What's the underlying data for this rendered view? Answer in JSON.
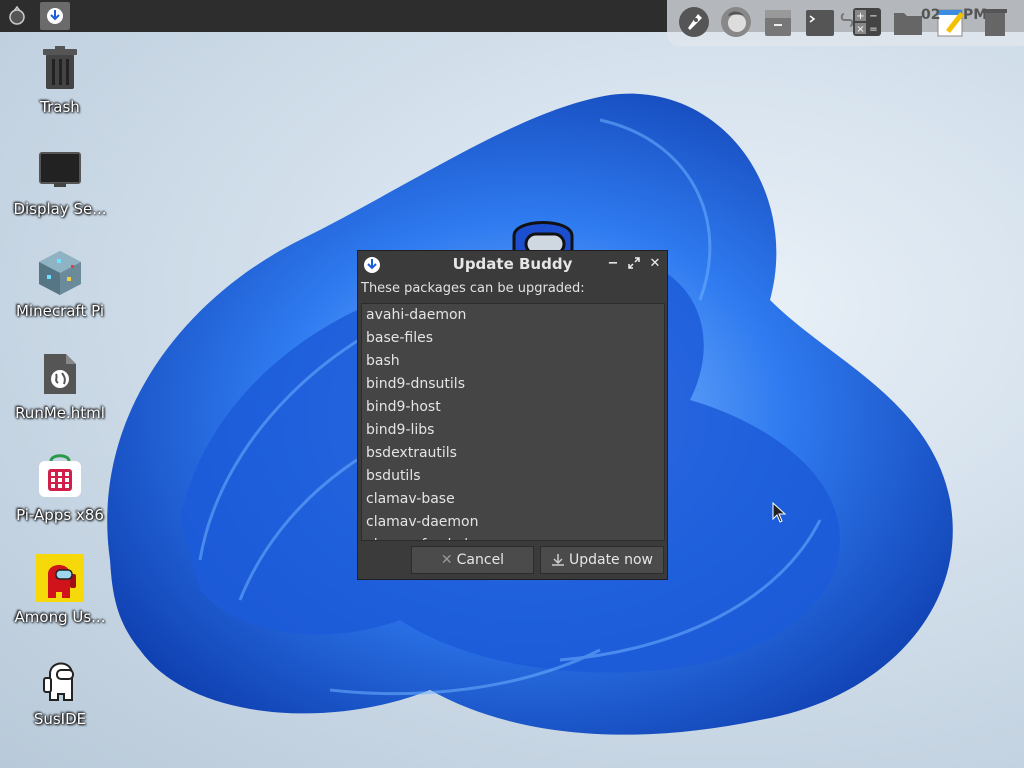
{
  "top_panel": {
    "menu_icon": "raspberry-menu-icon",
    "task_icon": "update-buddy-task-icon"
  },
  "dock": {
    "items": [
      "rocket-icon",
      "firefox-icon",
      "file-cabinet-icon",
      "terminal-icon",
      "link-icon",
      "calculator-icon",
      "folder-icon",
      "text-editor-icon",
      "trash-icon"
    ],
    "clock_text": "02",
    "clock_suffix": "PM"
  },
  "desktop": {
    "icons": [
      {
        "label": "Trash",
        "icon": "trash-icon"
      },
      {
        "label": "Display Se...",
        "icon": "monitor-icon"
      },
      {
        "label": "Minecraft Pi",
        "icon": "minecraft-block-icon"
      },
      {
        "label": "RunMe.html",
        "icon": "html-file-icon"
      },
      {
        "label": "Pi-Apps x86",
        "icon": "pi-apps-icon"
      },
      {
        "label": "Among Us...",
        "icon": "among-us-icon"
      },
      {
        "label": "SusIDE",
        "icon": "sus-ide-icon"
      }
    ]
  },
  "dialog": {
    "title": "Update Buddy",
    "prompt": "These packages can be upgraded:",
    "packages": [
      "avahi-daemon",
      "base-files",
      "bash",
      "bind9-dnsutils",
      "bind9-host",
      "bind9-libs",
      "bsdextrautils",
      "bsdutils",
      "clamav-base",
      "clamav-daemon",
      "clamav-freshclam"
    ],
    "cancel_label": "Cancel",
    "update_label": "Update now"
  },
  "colors": {
    "panel": "#2d2d2d",
    "dialog_bg": "#3b3b3b",
    "list_bg": "#454545",
    "wallpaper_blue": "#1f5fd6"
  }
}
